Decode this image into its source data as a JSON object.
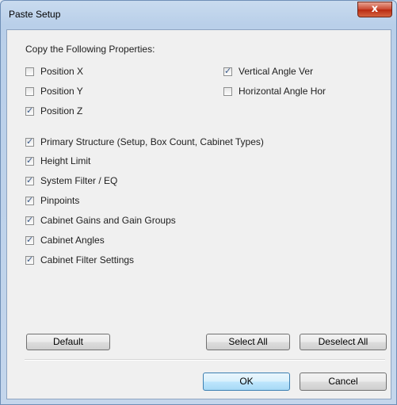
{
  "window": {
    "title": "Paste Setup",
    "close_symbol": "x"
  },
  "heading": "Copy the Following Properties:",
  "checkboxes": [
    {
      "label": "Position X",
      "checked": false
    },
    {
      "label": "Position Y",
      "checked": false
    },
    {
      "label": "Position Z",
      "checked": true
    },
    {
      "label": "Vertical Angle Ver",
      "checked": true
    },
    {
      "label": "Horizontal Angle Hor",
      "checked": false
    },
    {
      "label": "Primary Structure (Setup, Box Count, Cabinet Types)",
      "checked": true
    },
    {
      "label": "Height Limit",
      "checked": true
    },
    {
      "label": "System Filter / EQ",
      "checked": true
    },
    {
      "label": "Pinpoints",
      "checked": true
    },
    {
      "label": "Cabinet Gains and Gain Groups",
      "checked": true
    },
    {
      "label": "Cabinet Angles",
      "checked": true
    },
    {
      "label": "Cabinet Filter Settings",
      "checked": true
    }
  ],
  "buttons": {
    "default": "Default",
    "select_all": "Select All",
    "deselect_all": "Deselect All",
    "ok": "OK",
    "cancel": "Cancel"
  }
}
